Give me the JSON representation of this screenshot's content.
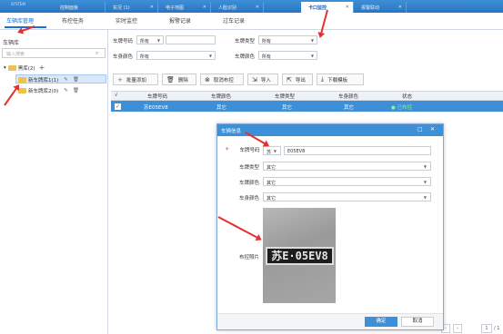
{
  "app": {
    "logo": "SYSTEM"
  },
  "tabs": [
    {
      "label": "控制面板",
      "active": false
    },
    {
      "label": "实况 (1)",
      "active": false
    },
    {
      "label": "电子地图",
      "active": false
    },
    {
      "label": "人脸识别",
      "active": false
    },
    {
      "label": "卡口监控",
      "active": true
    },
    {
      "label": "报警联动",
      "active": false
    }
  ],
  "subtabs": [
    "车辆库管理",
    "布控任务",
    "实时监控",
    "报警记录",
    "过车记录"
  ],
  "left": {
    "title": "车辆库",
    "search_placeholder": "输入搜索",
    "tree": [
      {
        "label": "黑库(2)",
        "level": 0
      },
      {
        "label": "新车牌库1(1)",
        "level": 1
      },
      {
        "label": "新车牌库2(0)",
        "level": 1
      }
    ]
  },
  "filters": {
    "plate_no_label": "车牌号码",
    "plate_no_prefix": "所有",
    "plate_type_label": "车牌类型",
    "plate_type_value": "所有",
    "body_color_label": "车身颜色",
    "body_color_value": "所有",
    "plate_color_label": "车牌颜色",
    "plate_color_value": "所有"
  },
  "toolbar": [
    "批量添加",
    "删除",
    "取消布控",
    "导入",
    "导出",
    "下载模板"
  ],
  "toolbar_icons": [
    "plus-icon",
    "trash-icon",
    "cancel-icon",
    "import-icon",
    "export-icon",
    "download-icon"
  ],
  "table": {
    "headers": [
      "车牌号码",
      "车牌颜色",
      "车牌类型",
      "车身颜色",
      "状态"
    ],
    "rows": [
      {
        "plate": "苏E05EV8",
        "plate_color": "其它",
        "plate_type": "其它",
        "body_color": "其它",
        "status": "已布控"
      }
    ]
  },
  "modal": {
    "title": "车辆信息",
    "fields": {
      "plate_no_label": "车牌号码",
      "province": "苏",
      "plate_no_value": "E05EV8",
      "plate_type_label": "车牌类型",
      "plate_type_value": "其它",
      "plate_color_label": "车牌颜色",
      "plate_color_value": "其它",
      "body_color_label": "车身颜色",
      "body_color_value": "其它",
      "photo_label": "布控照片",
      "plate_text": "苏E·05EV8"
    },
    "ok": "确定",
    "cancel": "取消"
  },
  "pagination": {
    "page": "1",
    "total": "/ 1"
  },
  "colors": {
    "accent": "#3d8fd8",
    "annotation_arrow": "#e53030"
  }
}
